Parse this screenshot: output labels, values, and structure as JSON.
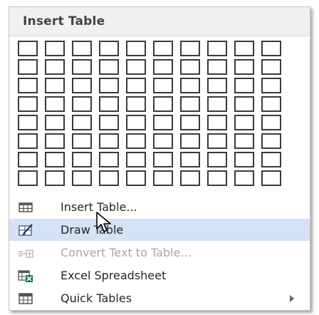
{
  "title": "Insert Table",
  "grid": {
    "rows": 8,
    "columns": 10
  },
  "menu": {
    "items": [
      {
        "id": "insert-table",
        "label": "Insert Table...",
        "icon": "table-icon",
        "state": "normal"
      },
      {
        "id": "draw-table",
        "label": "Draw Table",
        "icon": "pencil-table-icon",
        "state": "hover"
      },
      {
        "id": "convert-text",
        "label": "Convert Text to Table...",
        "icon": "convert-text-icon",
        "state": "disabled"
      },
      {
        "id": "excel-spreadsheet",
        "label": "Excel Spreadsheet",
        "icon": "excel-icon",
        "state": "normal"
      },
      {
        "id": "quick-tables",
        "label": "Quick Tables",
        "icon": "quick-tables-icon",
        "state": "normal",
        "submenu": true
      }
    ]
  },
  "colors": {
    "hover": "#d3e2f4",
    "header": "#f0f0f0",
    "excel": "#217346"
  }
}
